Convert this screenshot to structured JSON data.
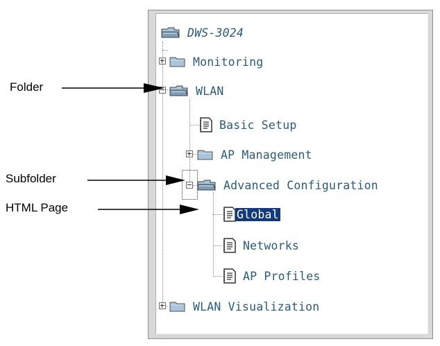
{
  "tree": {
    "root_label": "DWS-3024",
    "nodes": {
      "monitoring": "Monitoring",
      "wlan": "WLAN",
      "basic_setup": "Basic Setup",
      "ap_management": "AP Management",
      "advanced_configuration": "Advanced Configuration",
      "global": "Global",
      "networks": "Networks",
      "ap_profiles": "AP Profiles",
      "wlan_visualization": "WLAN Visualization"
    },
    "selected": "Global",
    "icons": {
      "closed_folder": "closed-folder-icon",
      "open_folder": "open-folder-icon",
      "page": "html-page-icon",
      "expand": "plus-expander-icon",
      "collapse": "minus-expander-icon"
    }
  },
  "callouts": {
    "folder": "Folder",
    "subfolder": "Subfolder",
    "html_page": "HTML Page"
  },
  "colors": {
    "link_text": "#2a5b7c",
    "selection_bg": "#123a7a",
    "folder_fill": "#a9c4dd",
    "panel_frame": "#d8d8d8"
  }
}
